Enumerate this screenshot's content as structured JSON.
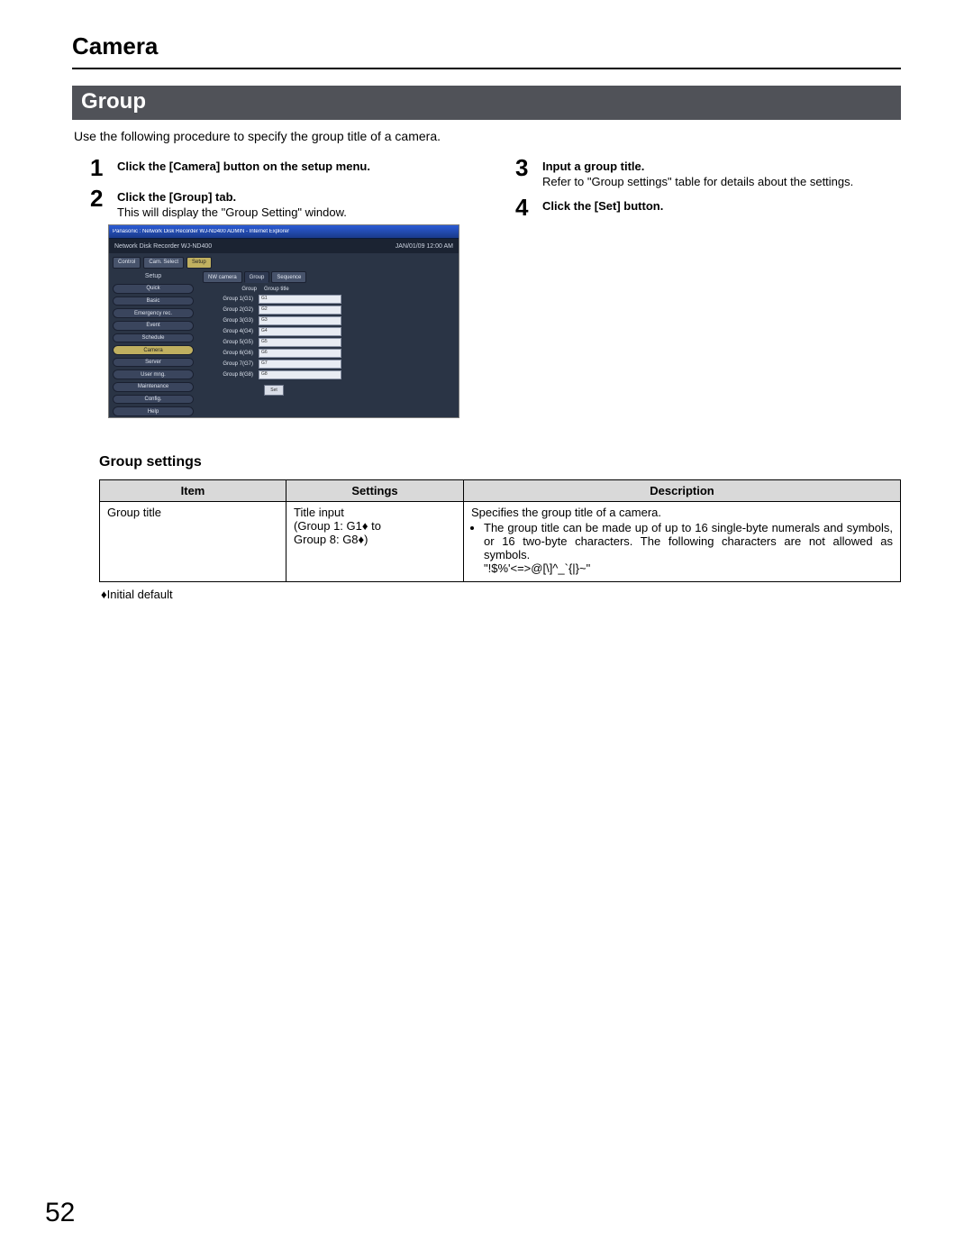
{
  "page": {
    "title": "Camera",
    "section": "Group",
    "intro": "Use the following procedure to specify the group title of a camera.",
    "page_number": "52"
  },
  "steps": {
    "s1": {
      "num": "1",
      "bold": "Click the [Camera] button on the setup menu."
    },
    "s2": {
      "num": "2",
      "bold": "Click the [Group] tab.",
      "desc": "This will display the \"Group Setting\" window."
    },
    "s3": {
      "num": "3",
      "bold": "Input a group title.",
      "desc": "Refer to \"Group settings\" table for details about the settings."
    },
    "s4": {
      "num": "4",
      "bold": "Click the [Set] button."
    }
  },
  "screenshot": {
    "window_title": "Panasonic : Network Disk Recorder WJ-ND400  ADMIN - Internet Explorer",
    "header_left": "Network Disk Recorder\nWJ-ND400",
    "header_right": "JAN/01/09  12:00  AM",
    "top_buttons": {
      "control": "Control",
      "cam_select": "Cam. Select",
      "setup": "Setup"
    },
    "side_header": "Setup",
    "nav": [
      "Quick",
      "Basic",
      "Emergency rec.",
      "Event",
      "Schedule",
      "Camera",
      "Server",
      "User mng.",
      "Maintenance",
      "Config.",
      "Help"
    ],
    "nav_selected": "Camera",
    "tabs": {
      "nw": "NW camera",
      "group": "Group",
      "sequence": "Sequence"
    },
    "tabs_selected": "Group",
    "grid_header": {
      "group": "Group",
      "title": "Group title"
    },
    "rows": [
      {
        "label": "Group 1(G1)",
        "value": "G1"
      },
      {
        "label": "Group 2(G2)",
        "value": "G2"
      },
      {
        "label": "Group 3(G3)",
        "value": "G3"
      },
      {
        "label": "Group 4(G4)",
        "value": "G4"
      },
      {
        "label": "Group 5(G5)",
        "value": "G5"
      },
      {
        "label": "Group 6(G6)",
        "value": "G6"
      },
      {
        "label": "Group 7(G7)",
        "value": "G7"
      },
      {
        "label": "Group 8(G8)",
        "value": "G8"
      }
    ],
    "set_button": "Set"
  },
  "group_settings": {
    "heading": "Group settings",
    "columns": {
      "item": "Item",
      "settings": "Settings",
      "description": "Description"
    },
    "row": {
      "item": "Group title",
      "settings_l1": "Title input",
      "settings_l2": "(Group 1: G1♦ to",
      "settings_l3": " Group 8: G8♦)",
      "desc_main": "Specifies the group title of a camera.",
      "desc_bullet": "The group title can be made up of up to 16 single-byte numerals and symbols, or 16 two-byte characters. The following characters are not allowed as symbols.",
      "desc_chars": "\"!$%'<=>@[\\]^_`{|}~\""
    },
    "footnote": "♦Initial default"
  }
}
